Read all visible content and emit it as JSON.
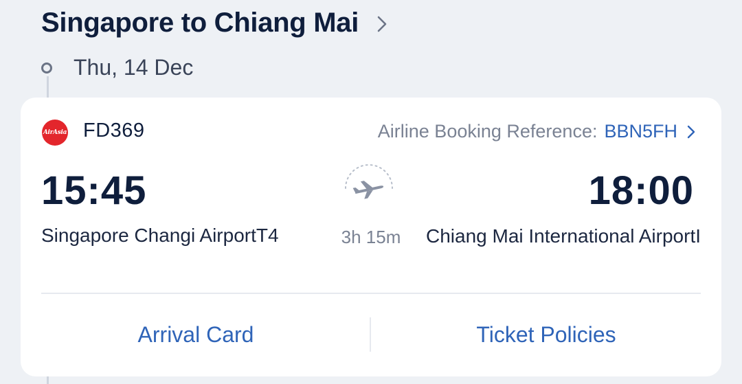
{
  "header": {
    "route_title": "Singapore to Chiang Mai",
    "date": "Thu, 14 Dec"
  },
  "flight": {
    "airline_logo_text": "AirAsia",
    "flight_number": "FD369",
    "booking_ref_label": "Airline Booking Reference:",
    "booking_ref_value": "BBN5FH",
    "departure_time": "15:45",
    "departure_airport": "Singapore Changi AirportT4",
    "arrival_time": "18:00",
    "arrival_airport": "Chiang Mai International AirportI",
    "duration": "3h 15m"
  },
  "actions": {
    "arrival_card": "Arrival Card",
    "ticket_policies": "Ticket Policies"
  },
  "icons": {
    "route": "chevron-right-icon",
    "booking": "chevron-right-icon",
    "timeline": "timeline-dot-icon",
    "flight": "plane-icon"
  },
  "colors": {
    "background": "#eef1f5",
    "card": "#ffffff",
    "title": "#0f1e3c",
    "link": "#2f64b8",
    "muted": "#7a8293",
    "airline_brand": "#e3262c"
  }
}
